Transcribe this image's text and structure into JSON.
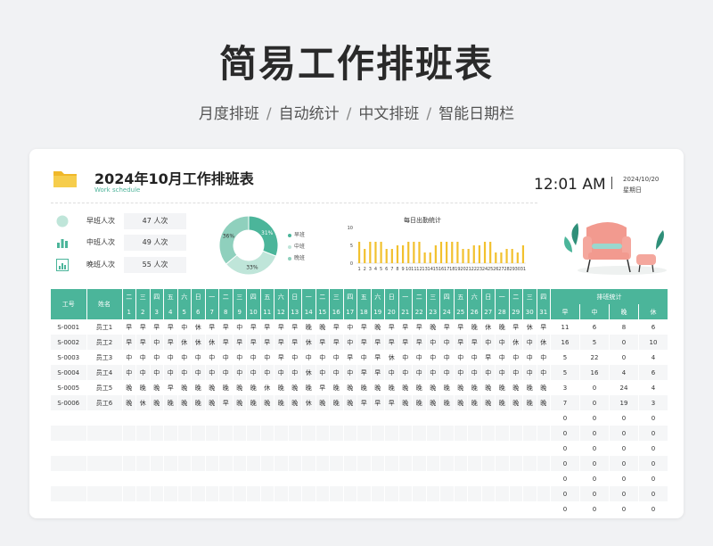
{
  "header": {
    "title": "简易工作排班表",
    "subtitle": [
      "月度排班",
      "自动统计",
      "中文排班",
      "智能日期栏"
    ],
    "subtitle_sep": "/"
  },
  "sheet": {
    "title": "2024年10月工作排班表",
    "subtitle_en": "Work schedule",
    "time": "12:01 AM",
    "date": "2024/10/20",
    "weekday": "星期日"
  },
  "stats": [
    {
      "label": "早班人次",
      "value": "47 人次",
      "icon": "circle-icon"
    },
    {
      "label": "中班人次",
      "value": "49 人次",
      "icon": "bar-chart-icon"
    },
    {
      "label": "晚班人次",
      "value": "55 人次",
      "icon": "line-chart-icon"
    }
  ],
  "donut": {
    "slices": [
      {
        "name": "早班",
        "pct": 31,
        "label": "31%",
        "color": "#4bb59a"
      },
      {
        "name": "中班",
        "pct": 33,
        "label": "33%",
        "color": "#bfe5d9"
      },
      {
        "name": "晚班",
        "pct": 36,
        "label": "36%",
        "color": "#8fd0bd"
      }
    ],
    "label_36": "36%",
    "label_31": "31%",
    "label_33": "33%"
  },
  "chart_data": {
    "type": "bar",
    "title": "每日出勤统计",
    "categories": [
      "1",
      "2",
      "3",
      "4",
      "5",
      "6",
      "7",
      "8",
      "9",
      "10",
      "11",
      "12",
      "13",
      "14",
      "15",
      "16",
      "17",
      "18",
      "19",
      "20",
      "21",
      "22",
      "23",
      "24",
      "25",
      "26",
      "27",
      "28",
      "29",
      "30",
      "31"
    ],
    "values": [
      6,
      4,
      6,
      6,
      6,
      4,
      4,
      5,
      5,
      6,
      6,
      6,
      3,
      3,
      5,
      6,
      6,
      6,
      6,
      4,
      4,
      5,
      5,
      6,
      6,
      3,
      3,
      4,
      4,
      3,
      5
    ],
    "ylim": [
      0,
      10
    ],
    "yticks": [
      "0",
      "5",
      "10"
    ],
    "xticks_shown": [
      "1",
      "2",
      "3",
      "4",
      "5",
      "6",
      "7",
      "8",
      "9",
      "10",
      "11",
      "12",
      "13",
      "14",
      "15",
      "16",
      "17",
      "18",
      "19",
      "20",
      "21",
      "22",
      "23",
      "24",
      "25",
      "26",
      "27",
      "28",
      "29",
      "30",
      "31"
    ],
    "bar_color": "#f2c12e"
  },
  "table": {
    "col_id": "工号",
    "col_name": "姓名",
    "summary_title": "排班统计",
    "summary_cols": [
      "早",
      "中",
      "晚",
      "休"
    ],
    "weekdays": [
      "二",
      "三",
      "四",
      "五",
      "六",
      "日",
      "一",
      "二",
      "三",
      "四",
      "五",
      "六",
      "日",
      "一",
      "二",
      "三",
      "四",
      "五",
      "六",
      "日",
      "一",
      "二",
      "三",
      "四",
      "五",
      "六",
      "日",
      "一",
      "二",
      "三",
      "四"
    ],
    "days": [
      "1",
      "2",
      "3",
      "4",
      "5",
      "6",
      "7",
      "8",
      "9",
      "10",
      "11",
      "12",
      "13",
      "14",
      "15",
      "16",
      "17",
      "18",
      "19",
      "20",
      "21",
      "22",
      "23",
      "24",
      "25",
      "26",
      "27",
      "28",
      "29",
      "30",
      "31"
    ],
    "rows": [
      {
        "id": "S-0001",
        "name": "员工1",
        "shifts": [
          "早",
          "早",
          "早",
          "早",
          "中",
          "休",
          "早",
          "早",
          "中",
          "早",
          "早",
          "早",
          "早",
          "晚",
          "晚",
          "早",
          "中",
          "早",
          "晚",
          "早",
          "早",
          "早",
          "晚",
          "早",
          "早",
          "晚",
          "休",
          "晚",
          "早",
          "休",
          "早"
        ],
        "sum": [
          "11",
          "6",
          "8",
          "6"
        ]
      },
      {
        "id": "S-0002",
        "name": "员工2",
        "shifts": [
          "早",
          "早",
          "中",
          "早",
          "休",
          "休",
          "休",
          "早",
          "早",
          "早",
          "早",
          "早",
          "早",
          "休",
          "早",
          "早",
          "中",
          "早",
          "早",
          "早",
          "早",
          "早",
          "中",
          "中",
          "早",
          "早",
          "中",
          "中",
          "休",
          "中",
          "休"
        ],
        "sum": [
          "16",
          "5",
          "0",
          "10"
        ]
      },
      {
        "id": "S-0003",
        "name": "员工3",
        "shifts": [
          "中",
          "中",
          "中",
          "中",
          "中",
          "中",
          "中",
          "中",
          "中",
          "中",
          "中",
          "早",
          "中",
          "中",
          "中",
          "中",
          "早",
          "中",
          "早",
          "休",
          "中",
          "中",
          "中",
          "中",
          "中",
          "中",
          "早",
          "中",
          "中",
          "中",
          "中"
        ],
        "sum": [
          "5",
          "22",
          "0",
          "4"
        ]
      },
      {
        "id": "S-0004",
        "name": "员工4",
        "shifts": [
          "中",
          "中",
          "中",
          "中",
          "中",
          "中",
          "中",
          "中",
          "中",
          "中",
          "中",
          "中",
          "中",
          "休",
          "中",
          "中",
          "中",
          "早",
          "早",
          "中",
          "中",
          "中",
          "中",
          "中",
          "中",
          "中",
          "中",
          "中",
          "中",
          "中",
          "中"
        ],
        "sum": [
          "5",
          "16",
          "4",
          "6"
        ]
      },
      {
        "id": "S-0005",
        "name": "员工5",
        "shifts": [
          "晚",
          "晚",
          "晚",
          "早",
          "晚",
          "晚",
          "晚",
          "晚",
          "晚",
          "晚",
          "休",
          "晚",
          "晚",
          "晚",
          "早",
          "晚",
          "晚",
          "晚",
          "晚",
          "晚",
          "晚",
          "晚",
          "晚",
          "晚",
          "晚",
          "晚",
          "晚",
          "晚",
          "晚",
          "晚",
          "晚"
        ],
        "sum": [
          "3",
          "0",
          "24",
          "4"
        ]
      },
      {
        "id": "S-0006",
        "name": "员工6",
        "shifts": [
          "晚",
          "休",
          "晚",
          "晚",
          "晚",
          "晚",
          "晚",
          "早",
          "晚",
          "晚",
          "晚",
          "晚",
          "晚",
          "休",
          "晚",
          "晚",
          "晚",
          "早",
          "早",
          "早",
          "晚",
          "晚",
          "晚",
          "晚",
          "晚",
          "晚",
          "晚",
          "晚",
          "晚",
          "晚",
          "晚"
        ],
        "sum": [
          "7",
          "0",
          "19",
          "3"
        ]
      }
    ],
    "empty_rows": 7,
    "empty_sum": [
      "0",
      "0",
      "0",
      "0"
    ]
  }
}
